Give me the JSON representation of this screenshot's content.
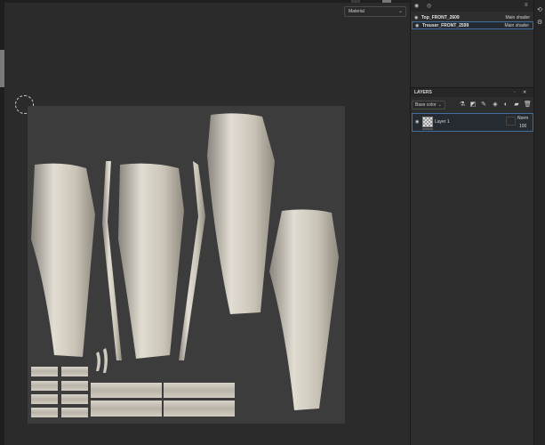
{
  "viewport": {
    "material_mode": "Material"
  },
  "texture_sets": {
    "items": [
      {
        "name": "Top_FRONT_2609",
        "shader": "Main shader"
      },
      {
        "name": "Trouser_FRONT_2599",
        "shader": "Main shader"
      }
    ]
  },
  "layers": {
    "title": "LAYERS",
    "channel": "Base color",
    "items": [
      {
        "name": "Layer 1",
        "blend_mode": "Norm",
        "opacity": "100"
      }
    ]
  },
  "colors": {
    "accent": "#3d6fa0",
    "panel": "#2d2d2d",
    "canvas": "#3c3c3c"
  },
  "icons": {
    "texture_set_header": [
      "visibility-icon",
      "eye-icon",
      "list-icon"
    ],
    "layer_tools": [
      "smart-material-icon",
      "mask-icon",
      "paint-icon",
      "fill-icon",
      "effect-icon",
      "folder-icon",
      "delete-icon"
    ],
    "right_toolbar": [
      "history-icon",
      "settings-icon"
    ]
  }
}
